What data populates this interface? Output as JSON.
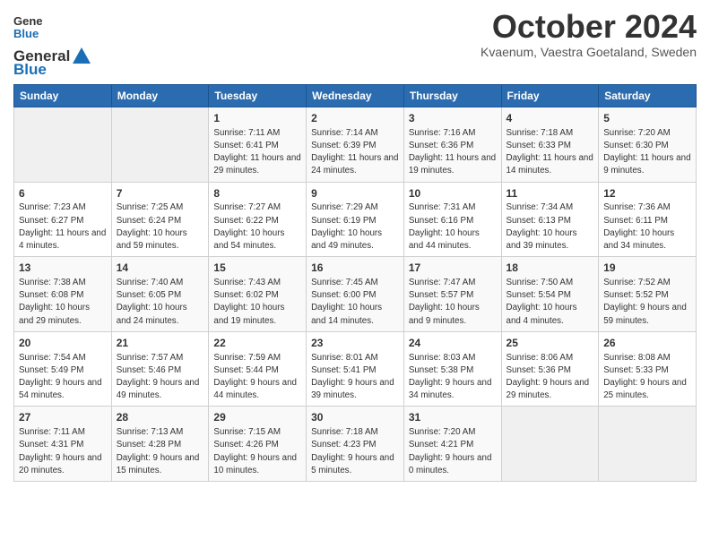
{
  "logo": {
    "general": "General",
    "blue": "Blue"
  },
  "title": {
    "month_year": "October 2024",
    "location": "Kvaenum, Vaestra Goetaland, Sweden"
  },
  "days_of_week": [
    "Sunday",
    "Monday",
    "Tuesday",
    "Wednesday",
    "Thursday",
    "Friday",
    "Saturday"
  ],
  "weeks": [
    [
      {
        "day": "",
        "info": ""
      },
      {
        "day": "",
        "info": ""
      },
      {
        "day": "1",
        "info": "Sunrise: 7:11 AM\nSunset: 6:41 PM\nDaylight: 11 hours and 29 minutes."
      },
      {
        "day": "2",
        "info": "Sunrise: 7:14 AM\nSunset: 6:39 PM\nDaylight: 11 hours and 24 minutes."
      },
      {
        "day": "3",
        "info": "Sunrise: 7:16 AM\nSunset: 6:36 PM\nDaylight: 11 hours and 19 minutes."
      },
      {
        "day": "4",
        "info": "Sunrise: 7:18 AM\nSunset: 6:33 PM\nDaylight: 11 hours and 14 minutes."
      },
      {
        "day": "5",
        "info": "Sunrise: 7:20 AM\nSunset: 6:30 PM\nDaylight: 11 hours and 9 minutes."
      }
    ],
    [
      {
        "day": "6",
        "info": "Sunrise: 7:23 AM\nSunset: 6:27 PM\nDaylight: 11 hours and 4 minutes."
      },
      {
        "day": "7",
        "info": "Sunrise: 7:25 AM\nSunset: 6:24 PM\nDaylight: 10 hours and 59 minutes."
      },
      {
        "day": "8",
        "info": "Sunrise: 7:27 AM\nSunset: 6:22 PM\nDaylight: 10 hours and 54 minutes."
      },
      {
        "day": "9",
        "info": "Sunrise: 7:29 AM\nSunset: 6:19 PM\nDaylight: 10 hours and 49 minutes."
      },
      {
        "day": "10",
        "info": "Sunrise: 7:31 AM\nSunset: 6:16 PM\nDaylight: 10 hours and 44 minutes."
      },
      {
        "day": "11",
        "info": "Sunrise: 7:34 AM\nSunset: 6:13 PM\nDaylight: 10 hours and 39 minutes."
      },
      {
        "day": "12",
        "info": "Sunrise: 7:36 AM\nSunset: 6:11 PM\nDaylight: 10 hours and 34 minutes."
      }
    ],
    [
      {
        "day": "13",
        "info": "Sunrise: 7:38 AM\nSunset: 6:08 PM\nDaylight: 10 hours and 29 minutes."
      },
      {
        "day": "14",
        "info": "Sunrise: 7:40 AM\nSunset: 6:05 PM\nDaylight: 10 hours and 24 minutes."
      },
      {
        "day": "15",
        "info": "Sunrise: 7:43 AM\nSunset: 6:02 PM\nDaylight: 10 hours and 19 minutes."
      },
      {
        "day": "16",
        "info": "Sunrise: 7:45 AM\nSunset: 6:00 PM\nDaylight: 10 hours and 14 minutes."
      },
      {
        "day": "17",
        "info": "Sunrise: 7:47 AM\nSunset: 5:57 PM\nDaylight: 10 hours and 9 minutes."
      },
      {
        "day": "18",
        "info": "Sunrise: 7:50 AM\nSunset: 5:54 PM\nDaylight: 10 hours and 4 minutes."
      },
      {
        "day": "19",
        "info": "Sunrise: 7:52 AM\nSunset: 5:52 PM\nDaylight: 9 hours and 59 minutes."
      }
    ],
    [
      {
        "day": "20",
        "info": "Sunrise: 7:54 AM\nSunset: 5:49 PM\nDaylight: 9 hours and 54 minutes."
      },
      {
        "day": "21",
        "info": "Sunrise: 7:57 AM\nSunset: 5:46 PM\nDaylight: 9 hours and 49 minutes."
      },
      {
        "day": "22",
        "info": "Sunrise: 7:59 AM\nSunset: 5:44 PM\nDaylight: 9 hours and 44 minutes."
      },
      {
        "day": "23",
        "info": "Sunrise: 8:01 AM\nSunset: 5:41 PM\nDaylight: 9 hours and 39 minutes."
      },
      {
        "day": "24",
        "info": "Sunrise: 8:03 AM\nSunset: 5:38 PM\nDaylight: 9 hours and 34 minutes."
      },
      {
        "day": "25",
        "info": "Sunrise: 8:06 AM\nSunset: 5:36 PM\nDaylight: 9 hours and 29 minutes."
      },
      {
        "day": "26",
        "info": "Sunrise: 8:08 AM\nSunset: 5:33 PM\nDaylight: 9 hours and 25 minutes."
      }
    ],
    [
      {
        "day": "27",
        "info": "Sunrise: 7:11 AM\nSunset: 4:31 PM\nDaylight: 9 hours and 20 minutes."
      },
      {
        "day": "28",
        "info": "Sunrise: 7:13 AM\nSunset: 4:28 PM\nDaylight: 9 hours and 15 minutes."
      },
      {
        "day": "29",
        "info": "Sunrise: 7:15 AM\nSunset: 4:26 PM\nDaylight: 9 hours and 10 minutes."
      },
      {
        "day": "30",
        "info": "Sunrise: 7:18 AM\nSunset: 4:23 PM\nDaylight: 9 hours and 5 minutes."
      },
      {
        "day": "31",
        "info": "Sunrise: 7:20 AM\nSunset: 4:21 PM\nDaylight: 9 hours and 0 minutes."
      },
      {
        "day": "",
        "info": ""
      },
      {
        "day": "",
        "info": ""
      }
    ]
  ]
}
